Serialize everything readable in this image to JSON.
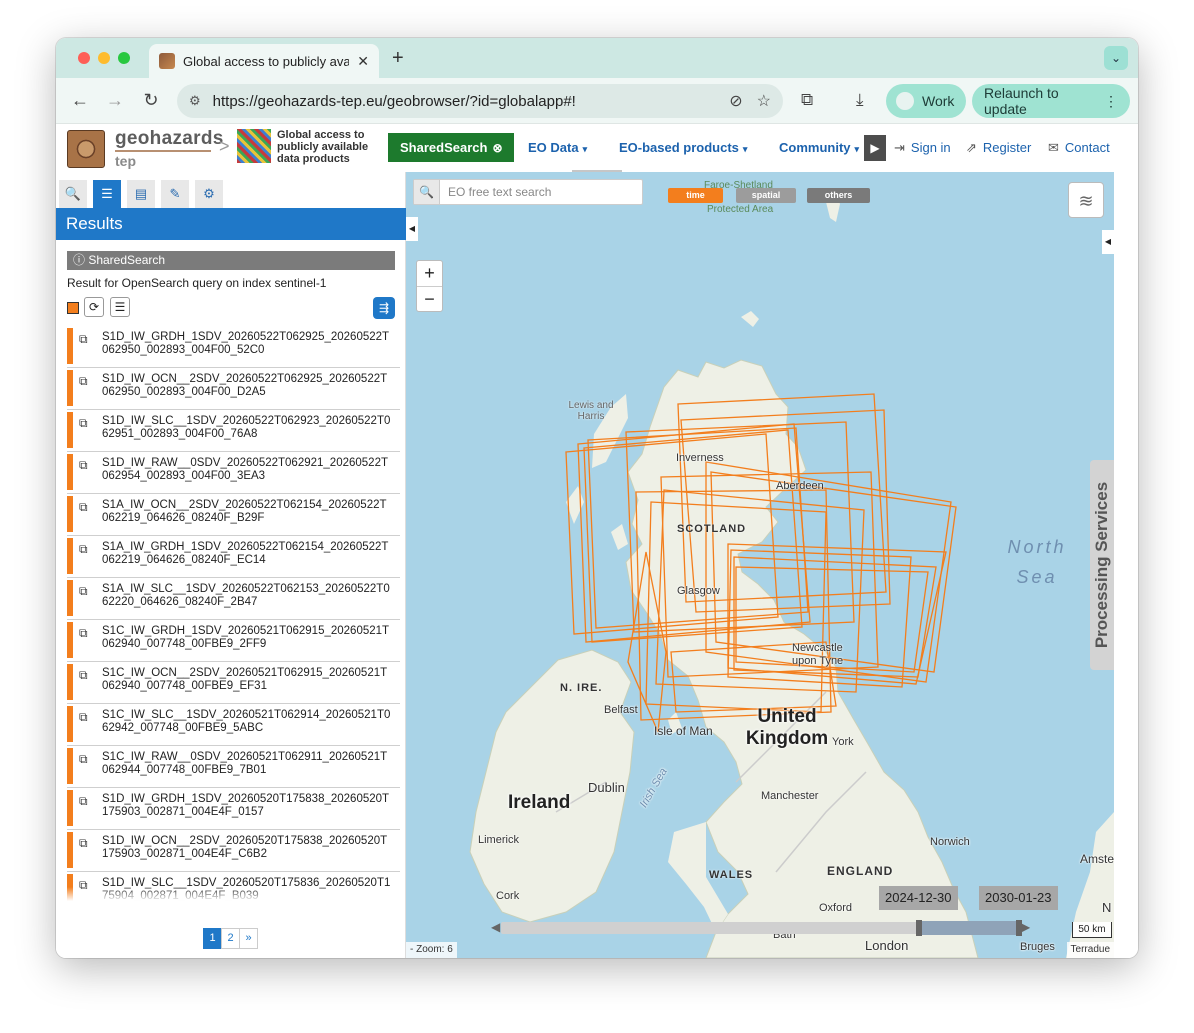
{
  "browser": {
    "tab_title": "Global access to publicly avai",
    "tab_close": "✕",
    "new_tab": "+",
    "tab_menu": "⌄",
    "url": "https://geohazards-tep.eu/geobrowser/?id=globalapp#!",
    "profile_label": "Work",
    "relaunch_label": "Relaunch to update",
    "relaunch_menu": "⋮",
    "icons": {
      "back": "←",
      "forward": "→",
      "reload": "↻",
      "site_settings": "⚙",
      "hide": "⊘",
      "star": "☆",
      "extensions": "⧉",
      "download": "⤓"
    }
  },
  "site": {
    "logo_text": "geohazards",
    "logo_sub": "tep",
    "breadcrumb_sep": ">",
    "app_title": "Global access to publicly available data products",
    "shared_search": "SharedSearch",
    "shared_search_close": "⊗",
    "menus": [
      {
        "label": "EO Data",
        "caret": "▾"
      },
      {
        "label": "EO-based products",
        "caret": "▾"
      },
      {
        "label": "Community",
        "caret": "▾"
      }
    ],
    "nav_arrow": "▶",
    "links": [
      {
        "label": "Sign in",
        "icon": "⇥"
      },
      {
        "label": "Register",
        "icon": "⇗"
      },
      {
        "label": "Contact",
        "icon": "✉"
      }
    ]
  },
  "left_panel": {
    "icon_buttons": [
      {
        "icon": "search-icon",
        "glyph": "🔍"
      },
      {
        "icon": "list-icon",
        "glyph": "☰"
      },
      {
        "icon": "archive-icon",
        "glyph": "▤"
      },
      {
        "icon": "pencil-icon",
        "glyph": "✎"
      },
      {
        "icon": "gear-icon",
        "glyph": "⚙"
      }
    ],
    "results_title": "Results",
    "shared_search_label": "ⓘ SharedSearch",
    "query_text": "Result for OpenSearch query on index sentinel-1",
    "tool_icons": {
      "refresh": "⟳",
      "menu": "☰",
      "share": "⇶"
    },
    "row_icon": "⧉",
    "results": [
      "S1D_IW_GRDH_1SDV_20260522T062925_20260522T062950_002893_004F00_52C0",
      "S1D_IW_OCN__2SDV_20260522T062925_20260522T062950_002893_004F00_D2A5",
      "S1D_IW_SLC__1SDV_20260522T062923_20260522T062951_002893_004F00_76A8",
      "S1D_IW_RAW__0SDV_20260522T062921_20260522T062954_002893_004F00_3EA3",
      "S1A_IW_OCN__2SDV_20260522T062154_20260522T062219_064626_08240F_B29F",
      "S1A_IW_GRDH_1SDV_20260522T062154_20260522T062219_064626_08240F_EC14",
      "S1A_IW_SLC__1SDV_20260522T062153_20260522T062220_064626_08240F_2B47",
      "S1C_IW_GRDH_1SDV_20260521T062915_20260521T062940_007748_00FBE9_2FF9",
      "S1C_IW_OCN__2SDV_20260521T062915_20260521T062940_007748_00FBE9_EF31",
      "S1C_IW_SLC__1SDV_20260521T062914_20260521T062942_007748_00FBE9_5ABC",
      "S1C_IW_RAW__0SDV_20260521T062911_20260521T062944_007748_00FBE9_7B01",
      "S1D_IW_GRDH_1SDV_20260520T175838_20260520T175903_002871_004E4F_0157",
      "S1D_IW_OCN__2SDV_20260520T175838_20260520T175903_002871_004E4F_C6B2",
      "S1D_IW_SLC__1SDV_20260520T175836_20260520T175904_002871_004E4F_B039"
    ],
    "pages": [
      "1",
      "2",
      "»"
    ],
    "active_page": "1"
  },
  "map": {
    "search_placeholder": "EO free text search",
    "search_icon": "🔍",
    "filters": {
      "time": "time",
      "spatial": "spatial",
      "others": "others"
    },
    "layers_icon": "≋",
    "collapse_left": "◀",
    "collapse_right": "◀",
    "zoom_in": "+",
    "zoom_out": "−",
    "processing_services": "Processing Services",
    "labels": {
      "faroe": "Faroe-Shetland",
      "faroe_sub": "Protected Area",
      "lewis": "Lewis and Harris",
      "inverness": "Inverness",
      "aberdeen": "Aberdeen",
      "scotland": "SCOTLAND",
      "north_sea": "North Sea",
      "glasgow": "Glasgow",
      "newcastle": "Newcastle upon Tyne",
      "n_ire": "N. IRE.",
      "belfast": "Belfast",
      "isle_of_man": "Isle of Man",
      "united_kingdom": "United Kingdom",
      "york": "York",
      "irish_sea": "Irish Sea",
      "dublin": "Dublin",
      "ireland": "Ireland",
      "manchester": "Manchester",
      "limerick": "Limerick",
      "norwich": "Norwich",
      "amsterdam": "Amste",
      "wales": "WALES",
      "england": "ENGLAND",
      "cork": "Cork",
      "oxford": "Oxford",
      "bath": "Bath",
      "london": "London",
      "bruges": "Bruges",
      "n_cut": "N"
    },
    "time_start": "2024-12-30",
    "time_end": "2030-01-23",
    "scale": "50 km",
    "zoom_text": "- Zoom: 6",
    "attribution": "Terradue",
    "footprint_color": "#f37e1d",
    "timeline_arrows": {
      "left": "◀",
      "right": "▶"
    }
  }
}
